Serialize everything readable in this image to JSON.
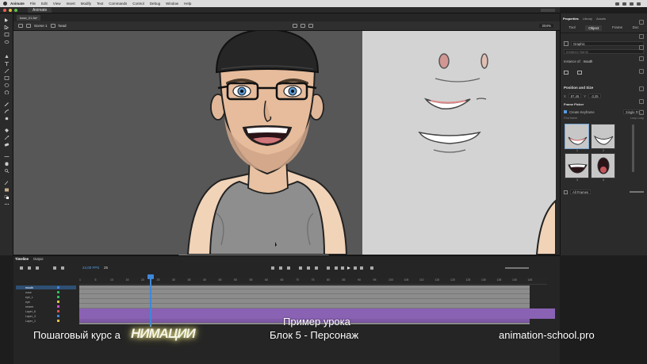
{
  "menubar": {
    "app": "Animate",
    "items": [
      "File",
      "Edit",
      "View",
      "Insert",
      "Modify",
      "Text",
      "Commands",
      "Control",
      "Debug",
      "Window",
      "Help"
    ]
  },
  "window": {
    "tab": "Animate"
  },
  "document": {
    "file_tab": "base_01.fla*"
  },
  "editbar": {
    "scene": "Scene 1",
    "symbol": "head",
    "zoom": "204%"
  },
  "properties": {
    "tabs": [
      "Properties",
      "Library",
      "Assets"
    ],
    "subtabs": [
      "Tool",
      "Object",
      "Frame",
      "Doc"
    ],
    "active_subtab": "Object",
    "symbol_type": "Graphic",
    "instance_name_placeholder": "Instance Name",
    "instance_label": "Instance of:",
    "instance_of": "mouth",
    "section_position": "Position and Size",
    "x_value": "87,45",
    "y_value": "-3,25",
    "frame_picker": "Frame Picker",
    "create_keyframe": "Create Keyframe",
    "keyframe_mode": "Single Fr...",
    "first_frame": "First frame",
    "loop_label": "Loop Loop",
    "thumb_labels": [
      "1",
      "2",
      "3",
      "4"
    ],
    "all_frames": "All Frames"
  },
  "timeline": {
    "tabs": [
      "Timeline",
      "Output"
    ],
    "active_tab": "Timeline",
    "fps": "24,00 FPS",
    "frame": "25",
    "ruler": [
      "1",
      "5",
      "10",
      "15",
      "20",
      "25",
      "30",
      "35",
      "40",
      "45",
      "50",
      "55",
      "60",
      "65",
      "70",
      "75",
      "80",
      "85",
      "90",
      "95",
      "100",
      "105",
      "110",
      "115",
      "120",
      "125",
      "130",
      "135",
      "140",
      "145"
    ],
    "layers": [
      "mouth",
      "nose",
      "eye_L",
      "eye",
      "nearer",
      "Layer_6",
      "Layer_3",
      "Layer_1"
    ],
    "selected_layer": "mouth"
  },
  "captions": {
    "course": "Пошаговый курс а",
    "logo": "НИМАЦИИ",
    "lesson_line1": "Пример урока",
    "lesson_line2": "Блок 5 - Персонаж",
    "site": "animation-school.pro"
  },
  "colors": {
    "accent_blue": "#3f87d8",
    "layer_purple": "#8a62b4",
    "stage_grey": "#575757",
    "reference_grey": "#d3d3d3"
  }
}
